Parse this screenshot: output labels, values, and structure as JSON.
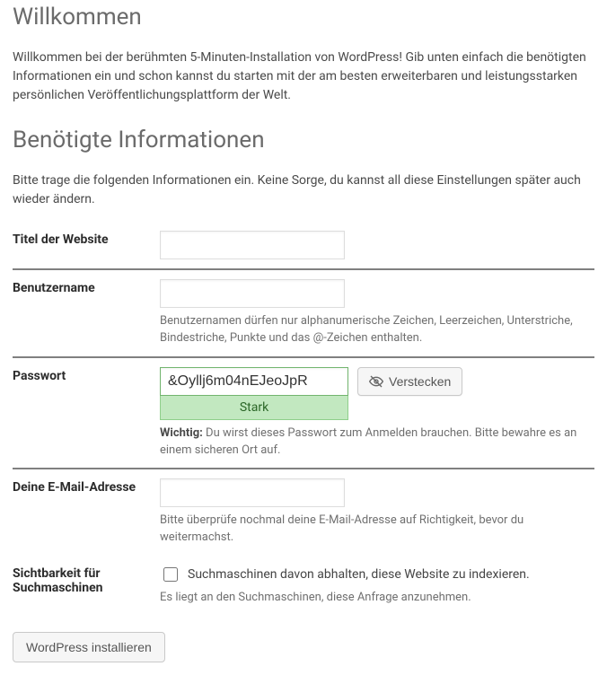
{
  "headings": {
    "welcome": "Willkommen",
    "required": "Benötigte Informationen"
  },
  "intro": {
    "welcome_text": "Willkommen bei der berühmten 5-Minuten-Installation von WordPress! Gib unten einfach die benötigten Informationen ein und schon kannst du starten mit der am besten erweiterbaren und leistungsstarken persönlichen Veröffentlichungsplattform der Welt.",
    "required_text": "Bitte trage die folgenden Informationen ein. Keine Sorge, du kannst all diese Einstellungen später auch wieder ändern."
  },
  "fields": {
    "site_title": {
      "label": "Titel der Website",
      "value": ""
    },
    "username": {
      "label": "Benutzername",
      "value": "",
      "hint": "Benutzernamen dürfen nur alphanumerische Zeichen, Leerzeichen, Unterstriche, Bindestriche, Punkte und das @-Zeichen enthalten."
    },
    "password": {
      "label": "Passwort",
      "value": "&Oyllj6m04nEJeoJpR",
      "strength": "Stark",
      "hide_button": "Verstecken",
      "note_prefix": "Wichtig:",
      "note_text": " Du wirst dieses Passwort zum Anmelden brauchen. Bitte bewahre es an einem sicheren Ort auf."
    },
    "email": {
      "label": "Deine E-Mail-Adresse",
      "value": "",
      "hint": "Bitte überprüfe nochmal deine E-Mail-Adresse auf Richtigkeit, bevor du weitermachst."
    },
    "visibility": {
      "label": "Sichtbarkeit für Suchmaschinen",
      "checkbox_label": "Suchmaschinen davon abhalten, diese Website zu indexieren.",
      "hint": "Es liegt an den Suchmaschinen, diese Anfrage anzunehmen."
    }
  },
  "submit": {
    "label": "WordPress installieren"
  }
}
